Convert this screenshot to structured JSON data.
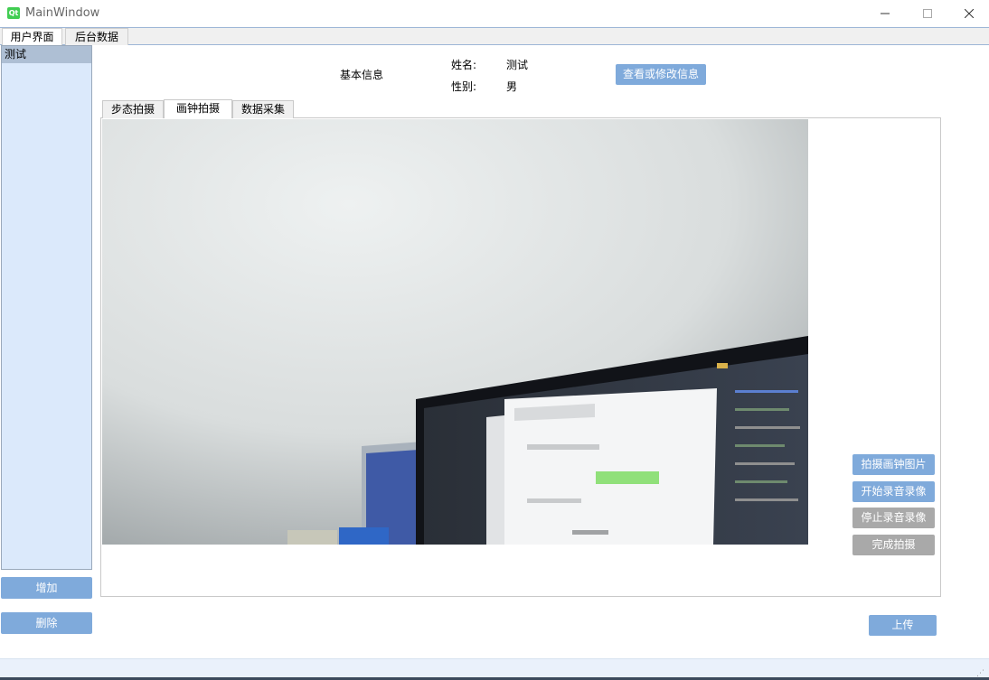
{
  "window": {
    "title": "MainWindow",
    "app_icon": "Qt",
    "minimize": "—",
    "maximize": "☐",
    "close": "✕"
  },
  "main_tabs": [
    "用户界面",
    "后台数据"
  ],
  "user_list": {
    "items": [
      "测试"
    ]
  },
  "left_buttons": {
    "add": "增加",
    "delete": "删除"
  },
  "info": {
    "basic_info_label": "基本信息",
    "name_label": "姓名:",
    "name_value": "测试",
    "gender_label": "性别:",
    "gender_value": "男",
    "edit_button": "查看或修改信息"
  },
  "sub_tabs": [
    "步态拍摄",
    "画钟拍摄",
    "数据采集"
  ],
  "side_buttons": [
    "拍摄画钟图片",
    "开始录音录像",
    "停止录音录像",
    "完成拍摄"
  ],
  "upload_button": "上传",
  "colors": {
    "button_blue": "#7faadb",
    "button_disabled": "#a9a9a9",
    "list_bg": "#dbe9fb",
    "list_selected": "#aebfd4"
  }
}
